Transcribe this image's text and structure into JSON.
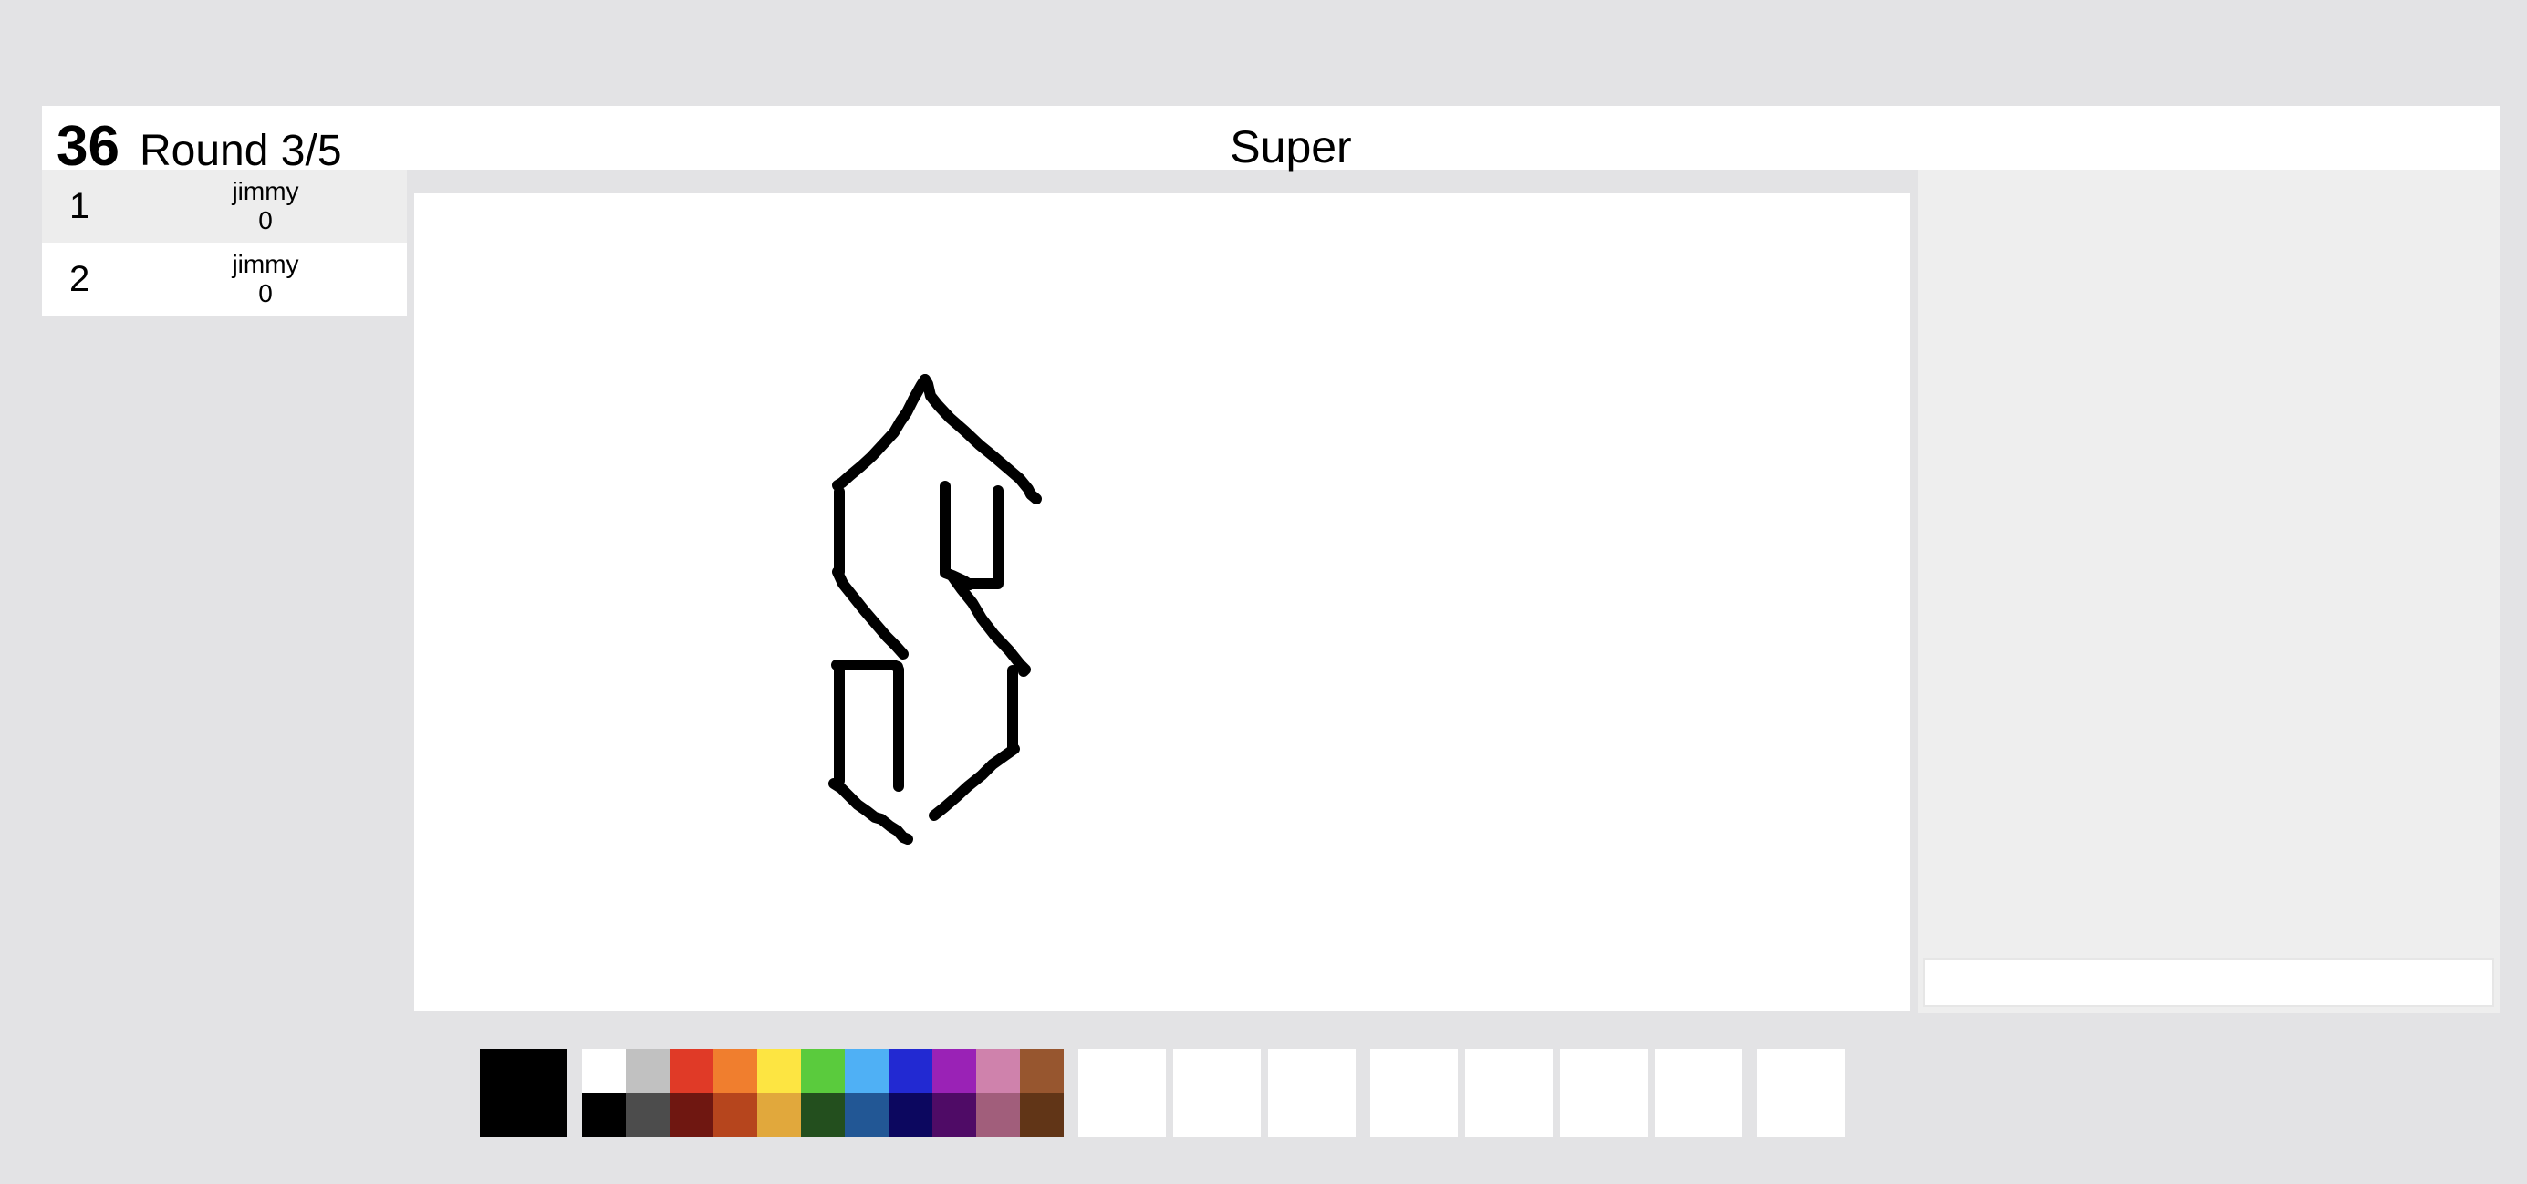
{
  "header": {
    "timer": "36",
    "round": "Round 3/5",
    "word": "Super"
  },
  "players": [
    {
      "rank": "1",
      "name": "jimmy",
      "score": "0"
    },
    {
      "rank": "2",
      "name": "jimmy",
      "score": "0"
    }
  ],
  "colors": {
    "background": "#e3e3e5",
    "current": "#000000",
    "stroke": "#000000"
  },
  "palette": {
    "top": [
      "#ffffff",
      "#c1c1c1",
      "#e03a27",
      "#f07e2e",
      "#fde542",
      "#5acb3d",
      "#4fb0f5",
      "#2229d2",
      "#9a22b6",
      "#cf82ac",
      "#97562f"
    ],
    "bottom": [
      "#000000",
      "#4c4c4c",
      "#6f1711",
      "#b6451d",
      "#e1a83c",
      "#234f1e",
      "#225795",
      "#0c075f",
      "#4f0b66",
      "#a15e7b",
      "#613517"
    ]
  },
  "tools": [
    {
      "name": "tool-1"
    },
    {
      "name": "tool-2"
    },
    {
      "name": "tool-3"
    },
    {
      "name": "tool-4"
    },
    {
      "name": "tool-5"
    },
    {
      "name": "tool-6"
    },
    {
      "name": "tool-7"
    },
    {
      "name": "tool-8"
    }
  ],
  "chat": {
    "input_value": ""
  }
}
